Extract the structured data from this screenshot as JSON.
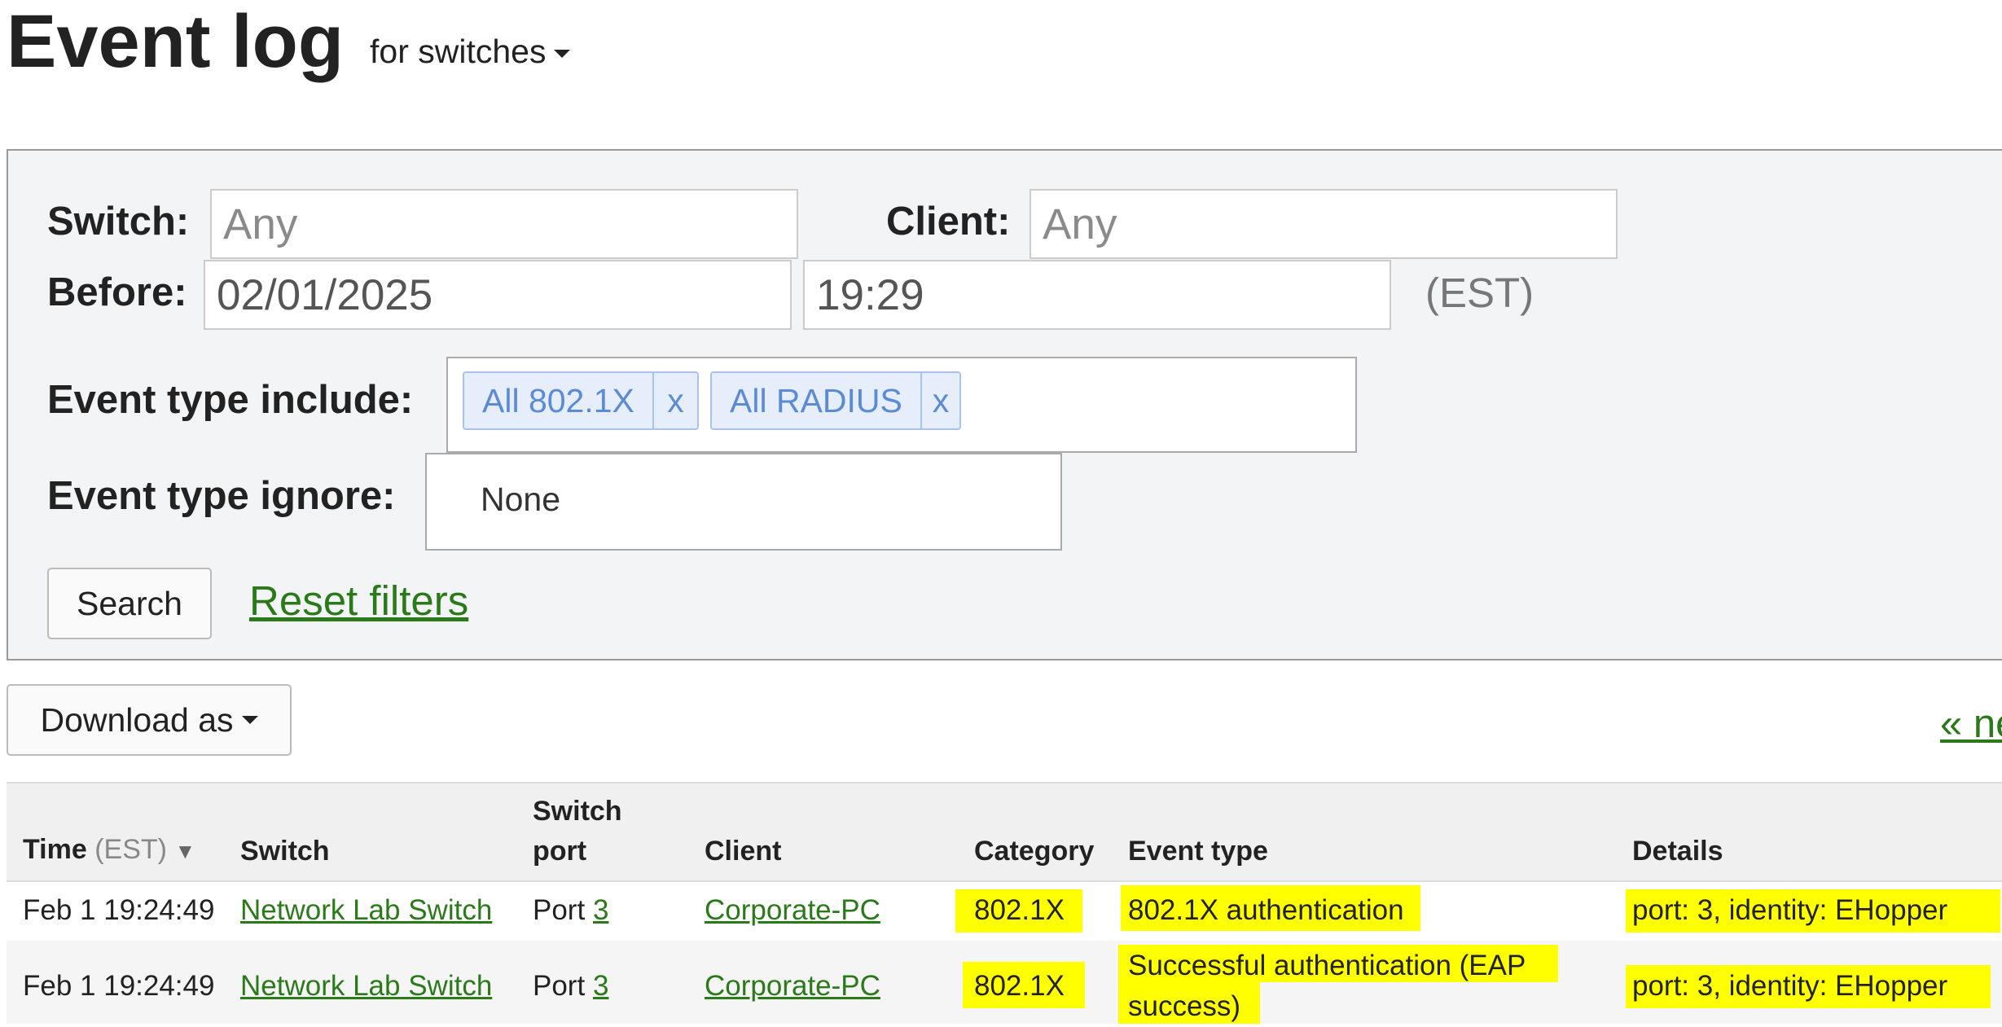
{
  "header": {
    "title": "Event log",
    "scope_label": "for switches"
  },
  "filters": {
    "switch_label": "Switch:",
    "switch_placeholder": "Any",
    "client_label": "Client:",
    "client_placeholder": "Any",
    "before_label": "Before:",
    "before_date": "02/01/2025",
    "before_time": "19:29",
    "timezone": "(EST)",
    "event_type_include_label": "Event type include:",
    "include_chips": [
      {
        "label": "All 802.1X",
        "remove": "x"
      },
      {
        "label": "All RADIUS",
        "remove": "x"
      }
    ],
    "event_type_ignore_label": "Event type ignore:",
    "ignore_value": "None",
    "search_button": "Search",
    "reset_link": "Reset filters"
  },
  "toolbar": {
    "download_label": "Download as",
    "pager_link": "« ne"
  },
  "table": {
    "headers": {
      "time": "Time",
      "time_tz": "(EST)",
      "time_sort": "▼",
      "switch": "Switch",
      "switch_port_line1": "Switch",
      "switch_port_line2": "port",
      "client": "Client",
      "category": "Category",
      "event_type": "Event type",
      "details": "Details"
    },
    "rows": [
      {
        "time": "Feb 1 19:24:49",
        "switch": "Network Lab Switch",
        "port_prefix": "Port",
        "port_num": "3",
        "client": "Corporate-PC",
        "category": "802.1X",
        "event_type_line1": "802.1X authentication",
        "event_type_line2": "",
        "details": "port: 3, identity: EHopper"
      },
      {
        "time": "Feb 1 19:24:49",
        "switch": "Network Lab Switch",
        "port_prefix": "Port",
        "port_num": "3",
        "client": "Corporate-PC",
        "category": "802.1X",
        "event_type_line1": "Successful authentication (EAP",
        "event_type_line2": "success)",
        "details": "port: 3, identity: EHopper"
      }
    ]
  },
  "colors": {
    "link_green": "#2b7a1a",
    "highlight": "#ffff00",
    "chip_blue": "#5b8ad6",
    "panel_bg": "#f3f4f6"
  }
}
